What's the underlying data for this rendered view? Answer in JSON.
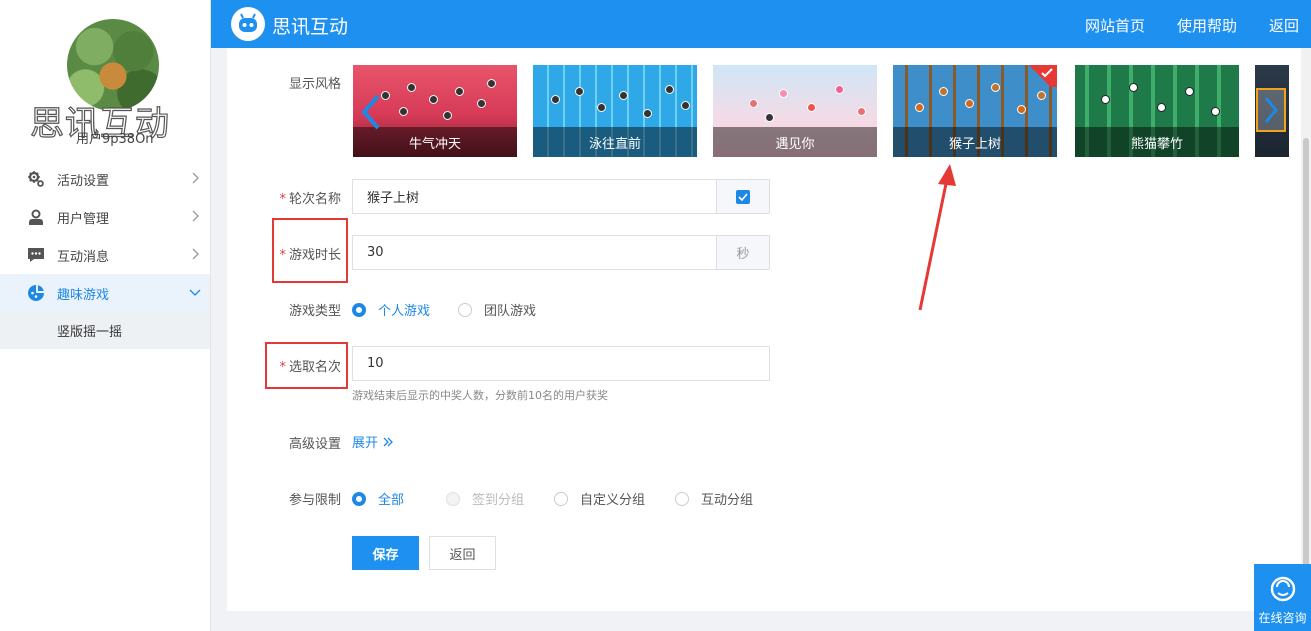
{
  "sidebar": {
    "watermark": "思讯互动",
    "username": "用户9p38On",
    "menu": [
      {
        "label": "活动设置",
        "icon": "gear-icon"
      },
      {
        "label": "用户管理",
        "icon": "user-icon"
      },
      {
        "label": "互动消息",
        "icon": "chat-icon"
      },
      {
        "label": "趣味游戏",
        "icon": "game-icon"
      }
    ],
    "submenu": [
      {
        "label": "竖版摇一摇"
      }
    ]
  },
  "topbar": {
    "brand": "思讯互动",
    "links": [
      "网站首页",
      "使用帮助",
      "返回"
    ]
  },
  "form": {
    "style_label": "显示风格",
    "styles": [
      {
        "name": "牛气冲天",
        "selected": false
      },
      {
        "name": "泳往直前",
        "selected": false
      },
      {
        "name": "遇见你",
        "selected": false
      },
      {
        "name": "猴子上树",
        "selected": true
      },
      {
        "name": "熊猫攀竹",
        "selected": false
      }
    ],
    "round_name_label": "轮次名称",
    "round_name_value": "猴子上树",
    "duration_label": "游戏时长",
    "duration_value": "30",
    "duration_unit": "秒",
    "game_type_label": "游戏类型",
    "game_type_options": [
      "个人游戏",
      "团队游戏"
    ],
    "rank_label": "选取名次",
    "rank_value": "10",
    "rank_hint": "游戏结束后显示的中奖人数，分数前10名的用户获奖",
    "advanced_label": "高级设置",
    "advanced_link": "展开",
    "limit_label": "参与限制",
    "limit_options": [
      "全部",
      "签到分组",
      "自定义分组",
      "互动分组"
    ],
    "save_label": "保存",
    "back_label": "返回"
  },
  "online": {
    "label": "在线咨询"
  },
  "colors": {
    "accent": "#1e90f0",
    "highlight": "#e53935"
  }
}
